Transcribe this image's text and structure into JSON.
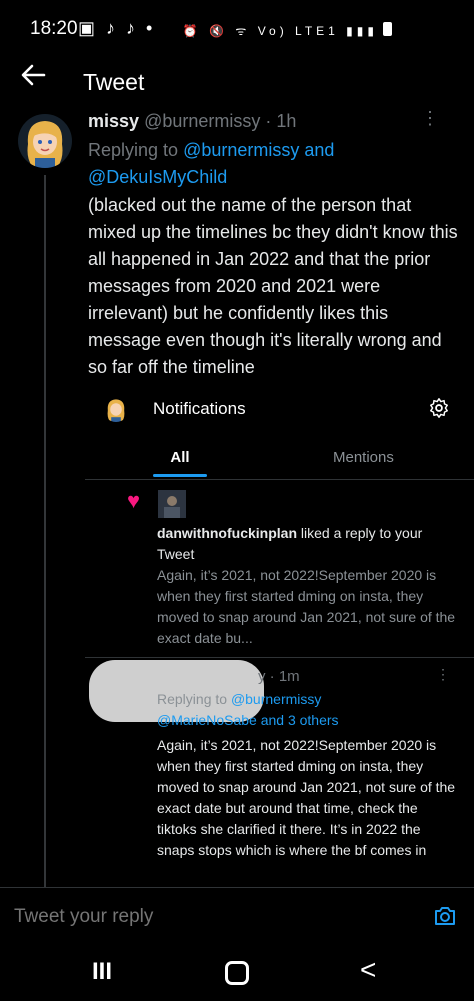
{
  "status_bar": {
    "time": "18:20",
    "left_icons": "▣ ♪ ♪ •",
    "right_icons": "⏰ 🔇 ᯤ Vo) LTE1 ▮▮▮"
  },
  "header": {
    "title": "Tweet"
  },
  "tweet": {
    "display_name": "missy",
    "handle_time": "@burnermissy · 1h",
    "replying_prefix": "Replying to",
    "replying_to_1": "@burnermissy and",
    "replying_to_2": "@DekuIsMyChild",
    "body": "(blacked out the name of the person that mixed up the timelines bc they didn't know this all happened in Jan 2022 and that the prior messages from 2020 and 2021 were irrelevant) but he confidently likes this message even though it's literally wrong and so far off the timeline"
  },
  "notifications_panel": {
    "title": "Notifications",
    "tabs": {
      "all": "All",
      "mentions": "Mentions"
    },
    "like_item": {
      "username": "danwithnofuckinplan",
      "action": " liked a reply to your Tweet",
      "quote": "Again, it’s 2021, not 2022!September 2020 is when they first started dming on insta, they moved to snap around Jan 2021, not sure of the exact date bu..."
    }
  },
  "reply_tweet": {
    "meta": "y · 1m",
    "replying_prefix": "Replying to",
    "replying_to_1": "@burnermissy",
    "replying_to_2": "@MarieNoSabe and 3 others",
    "body": "Again, it’s 2021, not 2022!September 2020 is when they first started dming on insta, they moved to snap around Jan 2021, not sure of the exact date but around that time, check the tiktoks she clarified it there. It’s in 2022 the snaps stops which is where the bf comes in"
  },
  "compose": {
    "placeholder": "Tweet your reply"
  },
  "nav": {
    "recents": "III",
    "back": "<"
  },
  "colors": {
    "accent": "#1d9bf0",
    "like": "#f91880",
    "muted": "#71767b"
  }
}
